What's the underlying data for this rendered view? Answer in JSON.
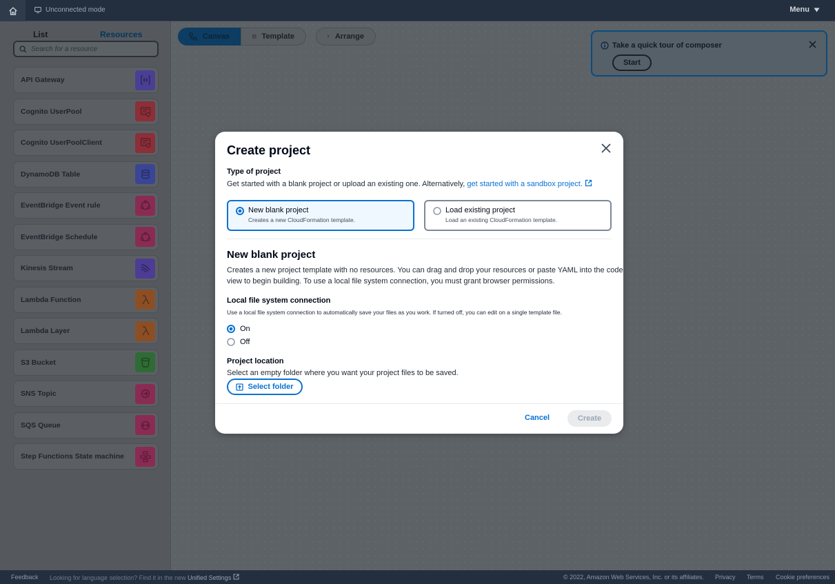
{
  "topbar": {
    "mode": "Unconnected mode",
    "menu": "Menu"
  },
  "left_panel": {
    "tabs": [
      {
        "label": "List"
      },
      {
        "label": "Resources"
      }
    ],
    "search_placeholder": "Search for a resource",
    "resources": [
      {
        "label": "API Gateway",
        "color": "#4b3f94"
      },
      {
        "label": "Cognito UserPool",
        "color": "#8b2f39"
      },
      {
        "label": "Cognito UserPoolClient",
        "color": "#8b2f39"
      },
      {
        "label": "DynamoDB Table",
        "color": "#3a4596"
      },
      {
        "label": "EventBridge Event rule",
        "color": "#8a2b54"
      },
      {
        "label": "EventBridge Schedule",
        "color": "#8a2b54"
      },
      {
        "label": "Kinesis Stream",
        "color": "#4d3c93"
      },
      {
        "label": "Lambda Function",
        "color": "#8c4f25"
      },
      {
        "label": "Lambda Layer",
        "color": "#8c4f25"
      },
      {
        "label": "S3 Bucket",
        "color": "#2f6b34"
      },
      {
        "label": "SNS Topic",
        "color": "#8a2b54"
      },
      {
        "label": "SQS Queue",
        "color": "#8a2b54"
      },
      {
        "label": "Step Functions State machine",
        "color": "#8a2b54"
      }
    ]
  },
  "canvas_toolbar": {
    "canvas": "Canvas",
    "template": "Template",
    "arrange": "Arrange"
  },
  "tour": {
    "title": "Take a quick tour of composer",
    "start": "Start"
  },
  "modal": {
    "title": "Create project",
    "type_heading": "Type of project",
    "type_text": "Get started with a blank project or upload an existing one. Alternatively,",
    "sandbox_link": "get started with a sandbox project.",
    "options": [
      {
        "label": "New blank project",
        "desc": "Creates a new CloudFormation template.",
        "selected": true
      },
      {
        "label": "Load existing project",
        "desc": "Load an existing CloudFormation template.",
        "selected": false
      }
    ],
    "section_title": "New blank project",
    "section_text_1": "Creates a new project template with no resources. You can drag and drop your resources or paste YAML into the code",
    "section_text_2": "view to begin building. To use a local file system connection, you must grant browser permissions.",
    "lfs_heading": "Local file system connection",
    "lfs_text": "Use a local file system connection to automatically save your files as you work. If turned off, you can edit on a single template file.",
    "lfs_on": "On",
    "lfs_off": "Off",
    "location_heading": "Project location",
    "location_text": "Select an empty folder where you want your project files to be saved.",
    "select_folder": "Select folder",
    "cancel": "Cancel",
    "create": "Create"
  },
  "footer": {
    "feedback": "Feedback",
    "lang_text": "Looking for language selection? Find it in the new",
    "lang_link": "Unified Settings",
    "copyright": "© 2022, Amazon Web Services, Inc. or its affiliates.",
    "privacy": "Privacy",
    "terms": "Terms",
    "cookie": "Cookie preferences"
  },
  "colors": {
    "accent": "#0972d3",
    "topbar": "#232f3e"
  }
}
